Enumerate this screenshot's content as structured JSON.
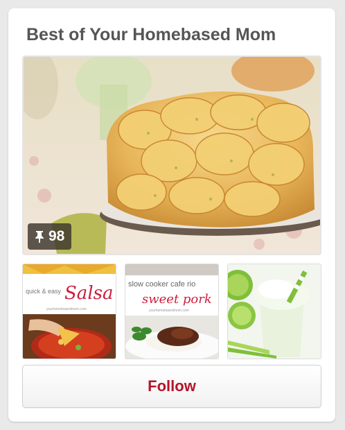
{
  "board": {
    "title": "Best of Your Homebased Mom",
    "pin_count": "98",
    "follow_label": "Follow"
  },
  "thumbnails": [
    {
      "line1": "quick & easy",
      "line2": "Salsa",
      "url_text": "yourhomebasedmom.com"
    },
    {
      "line1": "slow cooker cafe rio",
      "line2": "sweet pork",
      "url_text": "yourhomebasedmom.com"
    },
    {
      "line1": "",
      "line2": "",
      "url_text": ""
    }
  ],
  "colors": {
    "follow_text": "#b4152a",
    "title_text": "#555555",
    "script_red": "#cc1f3d"
  },
  "icons": {
    "pin": "pin-icon"
  }
}
